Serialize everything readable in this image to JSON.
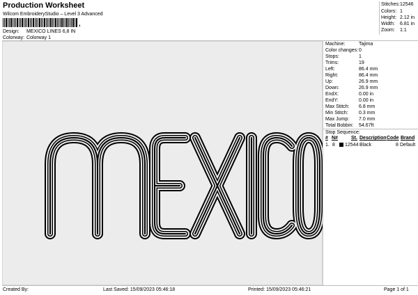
{
  "header": {
    "title": "Production Worksheet",
    "subtitle": "Wilcom EmbroideryStudio – Level 3 Advanced",
    "barcode_mark": ",",
    "design_label": "Design:",
    "design_value": "MEXICO LINES 6,8 IN",
    "colorway_label": "Colorway:",
    "colorway_value": "Colorway 1"
  },
  "summary": {
    "stitches_label": "Stitches:",
    "stitches_value": "12546",
    "colors_label": "Colors:",
    "colors_value": "1",
    "height_label": "Height:",
    "height_value": "2.12 in",
    "width_label": "Width:",
    "width_value": "6.81 in",
    "zoom_label": "Zoom:",
    "zoom_value": "1:1"
  },
  "specs": [
    {
      "label": "Machine:",
      "value": "Tajima"
    },
    {
      "label": "Color changes:",
      "value": "0"
    },
    {
      "label": "Stops:",
      "value": "1"
    },
    {
      "label": "Trims:",
      "value": "19"
    },
    {
      "label": "Left:",
      "value": "86.4 mm"
    },
    {
      "label": "Right:",
      "value": "86.4 mm"
    },
    {
      "label": "Up:",
      "value": "26.9 mm"
    },
    {
      "label": "Down:",
      "value": "26.9 mm"
    },
    {
      "label": "EndX:",
      "value": "0.00 in"
    },
    {
      "label": "EndY:",
      "value": "0.00 in"
    },
    {
      "label": "Max Stitch:",
      "value": "6.8 mm"
    },
    {
      "label": "Min Stitch:",
      "value": "0.3 mm"
    },
    {
      "label": "Max Jump:",
      "value": "7.0 mm"
    },
    {
      "label": "Total Bobbin:",
      "value": "54.67ft"
    }
  ],
  "sequence": {
    "title": "Stop Sequence:",
    "headers": {
      "num": "#",
      "n": "N#",
      "st": "St.",
      "desc": "Description",
      "code": "Code",
      "brand": "Brand"
    },
    "rows": [
      {
        "num": "1.",
        "n": "8",
        "color": "#000000",
        "st": "12544",
        "desc": "Black",
        "code": "8",
        "brand": "Default"
      }
    ]
  },
  "design_text": "MEXICO",
  "thread_color": "#000000",
  "footer": {
    "created": "Created By:",
    "saved": "Last Saved: 15/09/2023 05:46:18",
    "printed": "Printed: 15/09/2023 05:46:21",
    "page": "Page 1 of 1"
  }
}
